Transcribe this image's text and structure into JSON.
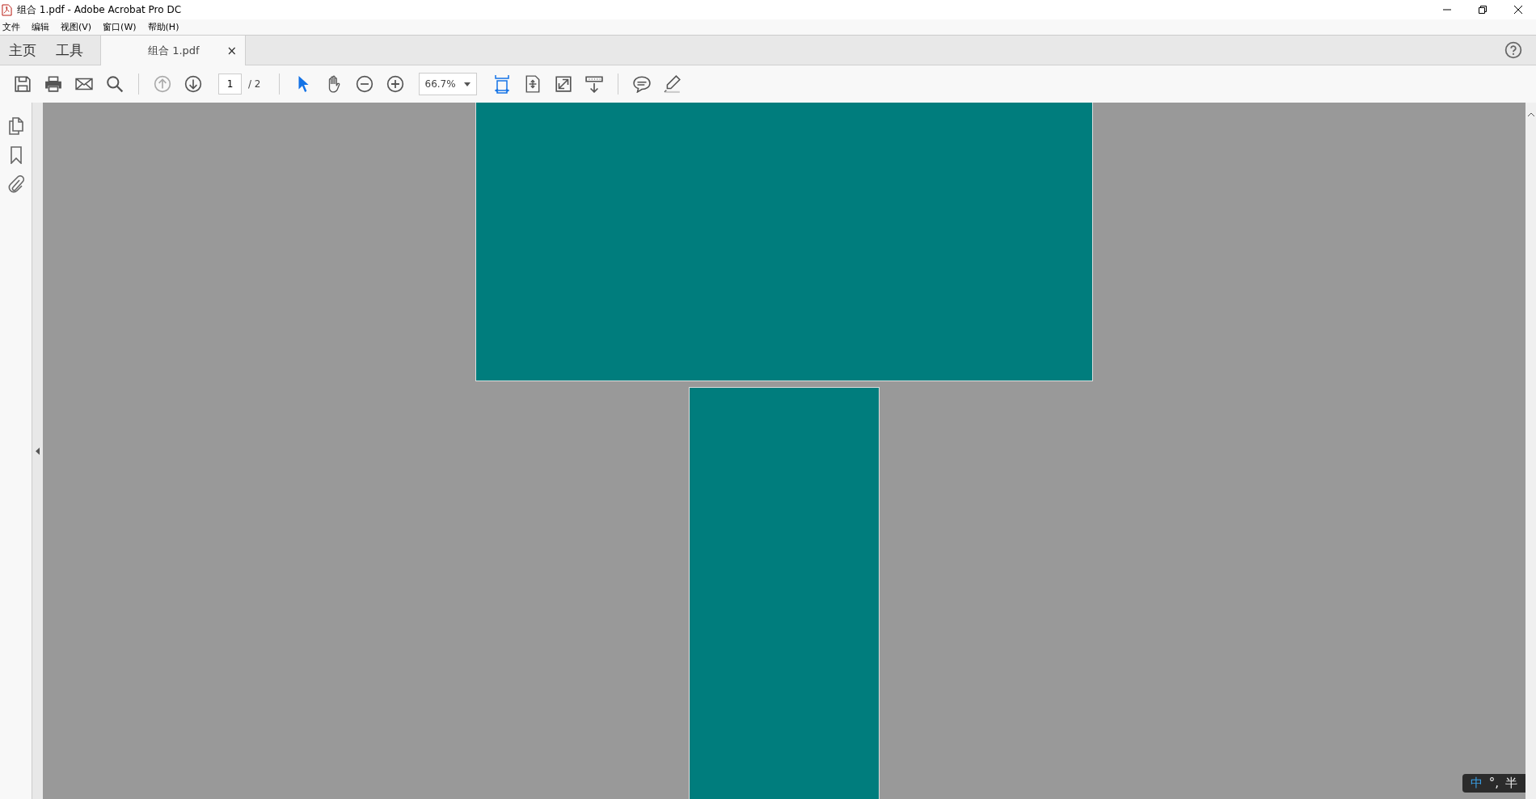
{
  "window": {
    "title": "组合 1.pdf - Adobe Acrobat Pro DC"
  },
  "menu": [
    "文件",
    "编辑",
    "视图(V)",
    "窗口(W)",
    "帮助(H)"
  ],
  "tabs": [
    {
      "label": "主页",
      "selected": false
    },
    {
      "label": "工具",
      "selected": false
    },
    {
      "label": "组合 1.pdf",
      "selected": true,
      "close": "×"
    }
  ],
  "toolbar": {
    "page_field": "1",
    "page_total": "/ 2",
    "zoom": "66.7%"
  },
  "pages": [
    {
      "kind": "landscape",
      "color": "#007d7d"
    },
    {
      "kind": "portrait",
      "color": "#007d7d"
    }
  ],
  "ime_bar": {
    "mode": "中",
    "punctuation": "°,",
    "width": "半"
  }
}
